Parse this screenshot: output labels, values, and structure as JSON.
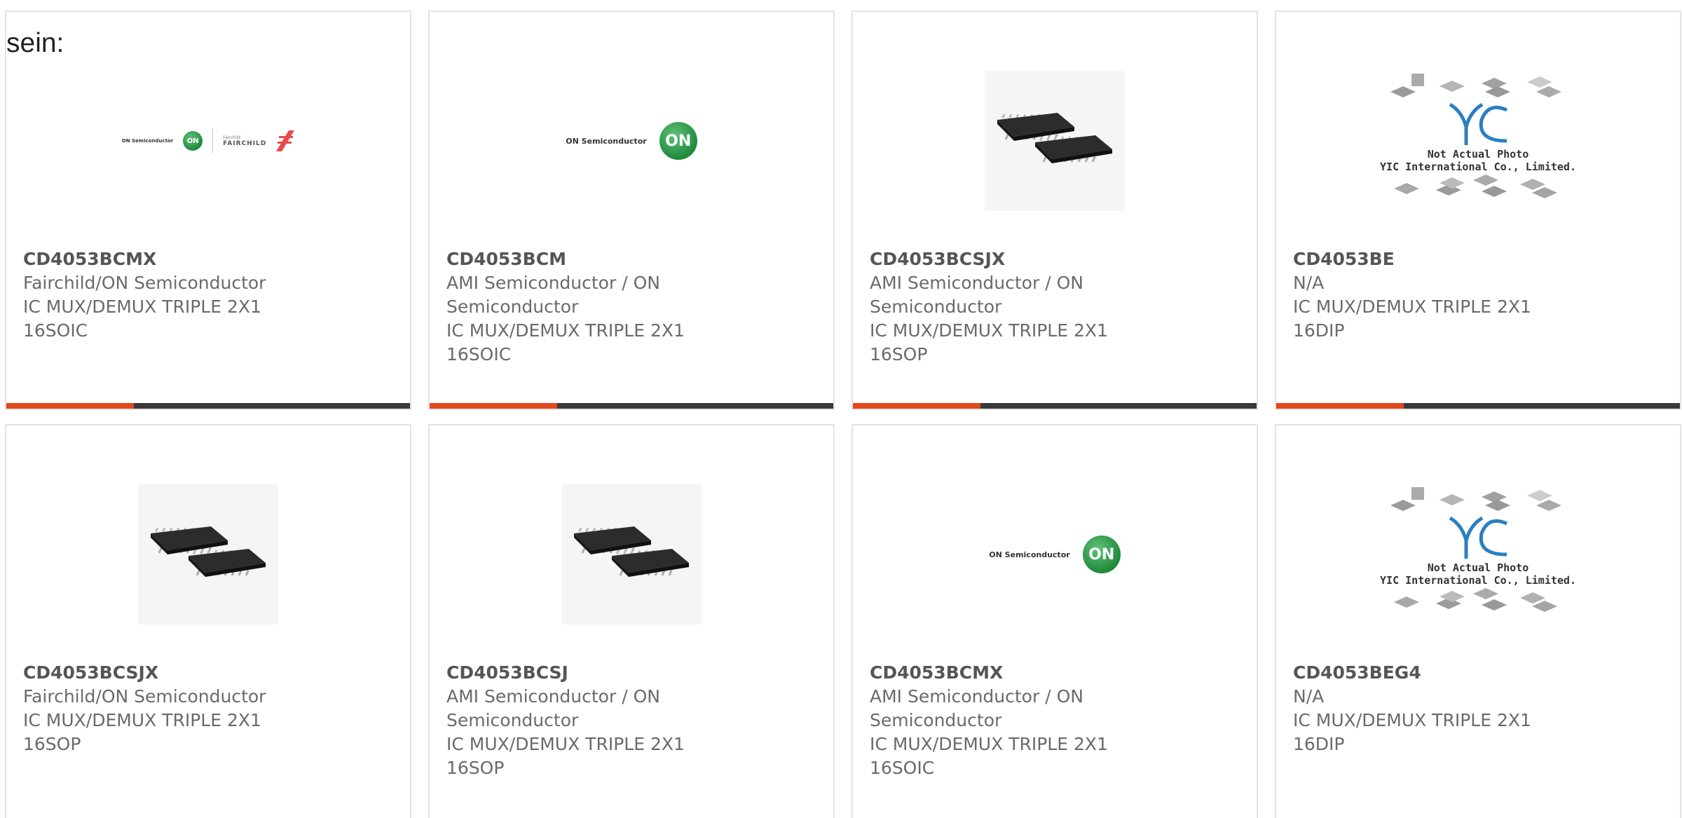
{
  "intro": {
    "text": "sein:"
  },
  "colors": {
    "accent": "#e3471c",
    "bar": "#3a3a3a",
    "border": "#e3e3e3",
    "on_green": "#1f8a3b"
  },
  "products": [
    {
      "part_number": "CD4053BCMX",
      "manufacturer": "Fairchild/ON Semiconductor",
      "description": "IC MUX/DEMUX TRIPLE 2X1 16SOIC",
      "image": "fairchild-on-logo-icon",
      "logo_text": "ON Semiconductor",
      "logo_text2": "Fairchild",
      "logo_text3": "FAIRCHILD",
      "logo_on": "ON"
    },
    {
      "part_number": "CD4053BCM",
      "manufacturer": "AMI Semiconductor / ON Semiconductor",
      "description": "IC MUX/DEMUX TRIPLE 2X1 16SOIC",
      "image": "on-semiconductor-logo-icon",
      "logo_text": "ON Semiconductor",
      "logo_on": "ON"
    },
    {
      "part_number": "CD4053BCSJX",
      "manufacturer": "AMI Semiconductor / ON Semiconductor",
      "description": "IC MUX/DEMUX TRIPLE 2X1 16SOP",
      "image": "chip-photo-icon"
    },
    {
      "part_number": "CD4053BE",
      "manufacturer": "N/A",
      "description": "IC MUX/DEMUX TRIPLE 2X1 16DIP",
      "image": "yic-placeholder-icon",
      "caption1": "Not Actual Photo",
      "caption2": "YIC International Co., Limited."
    },
    {
      "part_number": "CD4053BCSJX",
      "manufacturer": "Fairchild/ON Semiconductor",
      "description": "IC MUX/DEMUX TRIPLE 2X1 16SOP",
      "image": "chip-photo-icon"
    },
    {
      "part_number": "CD4053BCSJ",
      "manufacturer": "AMI Semiconductor / ON Semiconductor",
      "description": "IC MUX/DEMUX TRIPLE 2X1 16SOP",
      "image": "chip-photo-icon"
    },
    {
      "part_number": "CD4053BCMX",
      "manufacturer": "AMI Semiconductor / ON Semiconductor",
      "description": "IC MUX/DEMUX TRIPLE 2X1 16SOIC",
      "image": "on-semiconductor-logo-icon",
      "logo_text": "ON Semiconductor",
      "logo_on": "ON"
    },
    {
      "part_number": "CD4053BEG4",
      "manufacturer": "N/A",
      "description": "IC MUX/DEMUX TRIPLE 2X1 16DIP",
      "image": "yic-placeholder-icon",
      "caption1": "Not Actual Photo",
      "caption2": "YIC International Co., Limited."
    }
  ]
}
